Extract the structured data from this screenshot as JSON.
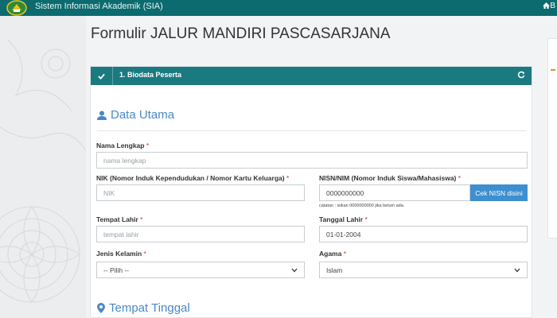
{
  "topbar": {
    "app_title": "Sistem Informasi Akademik (SIA)",
    "home_label": "B"
  },
  "page": {
    "title": "Formulir JALUR MANDIRI PASCASARJANA"
  },
  "step": {
    "label": "1. Biodata Peserta"
  },
  "sections": {
    "data_utama": "Data Utama",
    "tempat_tinggal": "Tempat Tinggal"
  },
  "form": {
    "nama": {
      "label": "Nama Lengkap",
      "placeholder": "nama lengkap"
    },
    "nik": {
      "label": "NIK (Nomor Induk Kependudukan / Nomor Kartu Keluarga)",
      "placeholder": "NIK"
    },
    "nisn": {
      "label": "NISN/NIM (Nomor Induk Siswa/Mahasiswa)",
      "value": "0000000000",
      "button": "Cek NISN disini",
      "note": "catatan : isikan 0000000000 jika belum ada."
    },
    "tempat_lahir": {
      "label": "Tempat Lahir",
      "placeholder": "tempat lahir"
    },
    "tanggal_lahir": {
      "label": "Tanggal Lahir",
      "value": "01-01-2004"
    },
    "jenis_kelamin": {
      "label": "Jenis Kelamin",
      "selected": "-- Pilih --"
    },
    "agama": {
      "label": "Agama",
      "selected": "Islam"
    },
    "required_mark": "*"
  },
  "colors": {
    "topbar": "#0b6b6e",
    "step_bar": "#1b7a80",
    "section_heading": "#4a88c7",
    "button": "#3d8fd0"
  }
}
